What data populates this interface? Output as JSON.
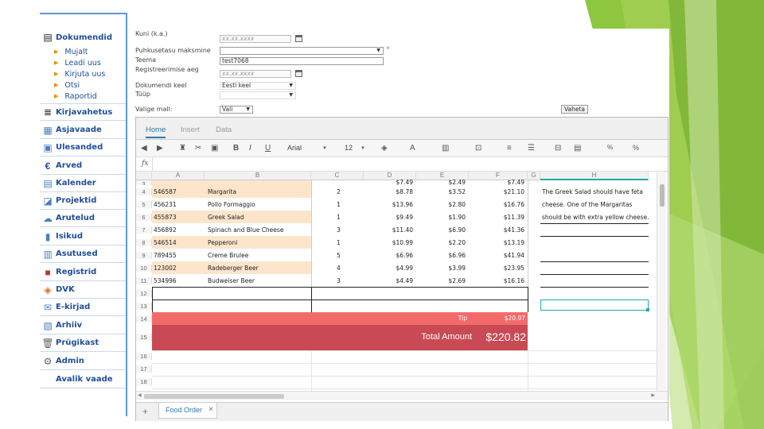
{
  "sidebar": {
    "header": "Dokumendid",
    "subitems": [
      "Mujalt",
      "Leadi uus",
      "Kirjuta uus",
      "Otsi",
      "Raportid"
    ],
    "items": [
      "Kirjavahetus",
      "Asjavaade",
      "Ülesanded",
      "Arved",
      "Kalender",
      "Projektid",
      "Arutelud",
      "Isikud",
      "Asutused",
      "Registrid",
      "DVK",
      "E-kirjad",
      "Arhiiv",
      "Prügikast",
      "Admin",
      "Avalik vaade"
    ]
  },
  "form": {
    "kuni_label": "Kuni (k.a.)",
    "kuni_placeholder": "xx.xx.xxxx",
    "fuhkusetasu_label": "Puhkusetasu maksmine",
    "required_mark": "*",
    "teema_label": "Teema",
    "teema_value": "test7068",
    "registreerimise_label": "Registreerimise aeg",
    "registreerimise_placeholder": "xx.xx.xxxx",
    "keel_label": "Dokumendi keel",
    "keel_value": "Eesti keel",
    "tuup_label": "Tüüp",
    "vali_mall_label": "Valige mall:",
    "vali_value": "Vali",
    "vaheta_button": "Vaheta"
  },
  "sheet": {
    "tabs": [
      "Home",
      "Insert",
      "Data"
    ],
    "toolbar": {
      "font": "Arial",
      "size": "12"
    },
    "fx_label": "fx",
    "columns": [
      "A",
      "B",
      "C",
      "D",
      "E",
      "F",
      "G",
      "H"
    ],
    "rows": [
      {
        "n": "3",
        "a": "",
        "b": "",
        "c": "",
        "d": "$7.49",
        "e": "$2.49",
        "f": "$7.49",
        "hl": false
      },
      {
        "n": "4",
        "a": "546587",
        "b": "Margarita",
        "c": "2",
        "d": "$8.78",
        "e": "$3.52",
        "f": "$21.10",
        "hl": true
      },
      {
        "n": "5",
        "a": "456231",
        "b": "Pollo Formaggio",
        "c": "1",
        "d": "$13.96",
        "e": "$2.80",
        "f": "$16.76",
        "hl": false
      },
      {
        "n": "6",
        "a": "455873",
        "b": "Greek Salad",
        "c": "1",
        "d": "$9.49",
        "e": "$1.90",
        "f": "$11.39",
        "hl": true
      },
      {
        "n": "7",
        "a": "456892",
        "b": "Spinach and Blue Cheese",
        "c": "3",
        "d": "$11.40",
        "e": "$6.90",
        "f": "$41.36",
        "hl": false
      },
      {
        "n": "8",
        "a": "546514",
        "b": "Pepperoni",
        "c": "1",
        "d": "$10.99",
        "e": "$2.20",
        "f": "$13.19",
        "hl": true
      },
      {
        "n": "9",
        "a": "789455",
        "b": "Creme Brulee",
        "c": "5",
        "d": "$6.96",
        "e": "$6.96",
        "f": "$41.94",
        "hl": false
      },
      {
        "n": "10",
        "a": "123002",
        "b": "Radeberger Beer",
        "c": "4",
        "d": "$4.99",
        "e": "$3.99",
        "f": "$23.95",
        "hl": true
      },
      {
        "n": "11",
        "a": "534996",
        "b": "Budweiser Beer",
        "c": "3",
        "d": "$4.49",
        "e": "$2.69",
        "f": "$16.16",
        "hl": false
      }
    ],
    "note_lines": [
      "The Greek Salad should have feta",
      "cheese. One of the Margaritas",
      "should be with extra yellow cheese."
    ],
    "tip_label": "Tip",
    "tip_value": "$20.97",
    "total_label": "Total Amount",
    "total_value": "$220.82",
    "extra_rows": [
      "12",
      "13",
      "14",
      "15",
      "16",
      "17",
      "18",
      "19"
    ],
    "sheet_tab": "Food Order",
    "add_sheet": "+",
    "close_tab": "×"
  },
  "colors": {
    "tip_band": "#f26b6b",
    "total_band": "#c94a54",
    "highlight": "#fde5cc",
    "accent": "#5b9bd5",
    "slide_green": "#8dc63f"
  }
}
